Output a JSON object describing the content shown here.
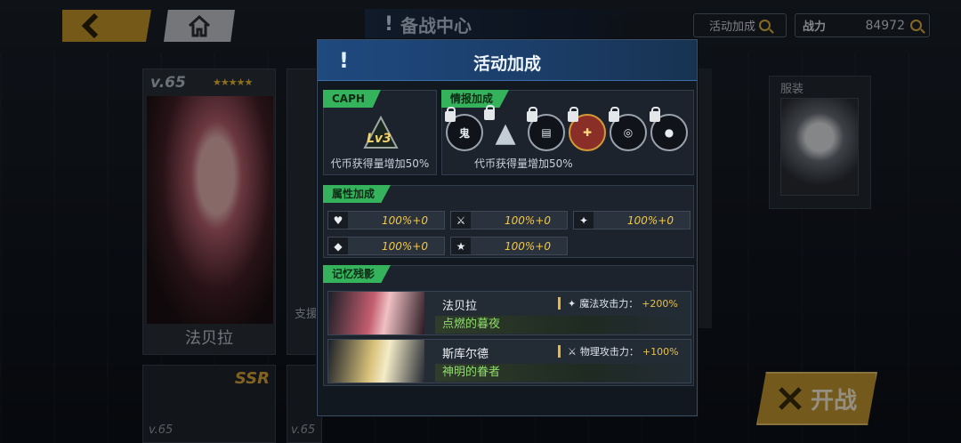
{
  "header": {
    "screen_title": "备战中心",
    "event_bonus_button": "活动加成",
    "power_label": "战力",
    "power_value": "84972"
  },
  "background": {
    "card1": {
      "level": "v.65",
      "name": "法贝拉"
    },
    "card2": {
      "role": "支援"
    },
    "costume_label": "服装",
    "bottom_card1": {
      "rarity": "SSR",
      "level": "v.65"
    },
    "bottom_card2": {
      "level": "v.65"
    },
    "fight_button": "开战"
  },
  "modal": {
    "title": "活动加成",
    "caph": {
      "tag": "CAPH",
      "badge_level": "Lv3",
      "bonus": "代币获得量增加50%"
    },
    "intel": {
      "tag": "情报加成",
      "emblems": [
        "icon-emblem-1",
        "icon-emblem-palantir",
        "icon-emblem-3",
        "icon-emblem-red",
        "icon-emblem-5",
        "icon-emblem-6"
      ],
      "bonus": "代币获得量增加50%"
    },
    "attributes": {
      "tag": "属性加成",
      "items": [
        {
          "icon": "heart-icon",
          "value": "100%+0"
        },
        {
          "icon": "sword-icon",
          "value": "100%+0"
        },
        {
          "icon": "wand-icon",
          "value": "100%+0"
        },
        {
          "icon": "shield-icon",
          "value": "100%+0"
        },
        {
          "icon": "star-icon",
          "value": "100%+0"
        }
      ]
    },
    "memories": {
      "tag": "记忆残影",
      "items": [
        {
          "character": "法贝拉",
          "title": "点燃的暮夜",
          "effect_label": "魔法攻击力：",
          "effect_value": "+200%"
        },
        {
          "character": "斯库尔德",
          "title": "神明的眷者",
          "effect_label": "物理攻击力：",
          "effect_value": "+100%"
        }
      ]
    }
  },
  "colors": {
    "accent_green": "#35b35c",
    "gold": "#e6c24a",
    "header_blue": "#1f4a7f"
  }
}
